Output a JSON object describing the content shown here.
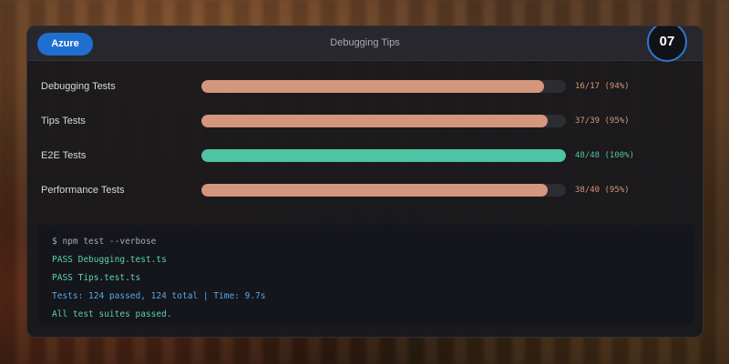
{
  "header": {
    "badge_label": "Azure",
    "title": "Debugging Tips",
    "step_number": "07"
  },
  "colors": {
    "partial": "#d4967c",
    "complete": "#4fc4a4",
    "accent": "#2b78d6"
  },
  "tests": [
    {
      "label": "Debugging Tests",
      "stat": "16/17 (94%)",
      "progress": 0.94,
      "status": "partial"
    },
    {
      "label": "Tips Tests",
      "stat": "37/39 (95%)",
      "progress": 0.95,
      "status": "partial"
    },
    {
      "label": "E2E Tests",
      "stat": "48/48 (100%)",
      "progress": 1.0,
      "status": "complete"
    },
    {
      "label": "Performance Tests",
      "stat": "38/40 (95%)",
      "progress": 0.95,
      "status": "partial"
    }
  ],
  "terminal": {
    "lines": [
      {
        "text": "$ npm test --verbose",
        "color": "#a6a9b0"
      },
      {
        "text": "PASS Debugging.test.ts",
        "color": "#5fd0a8"
      },
      {
        "text": "PASS Tips.test.ts",
        "color": "#5fd0a8"
      },
      {
        "text": "Tests: 124 passed, 124 total | Time: 9.7s",
        "color": "#5aa6e6"
      },
      {
        "text": "All test suites passed.",
        "color": "#5fd0a8"
      }
    ]
  }
}
